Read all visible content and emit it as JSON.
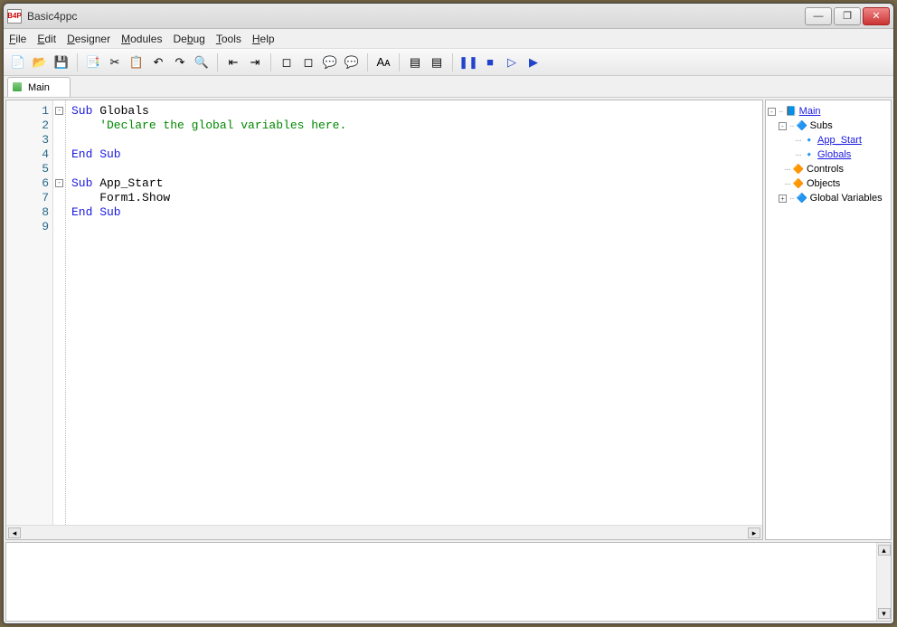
{
  "window": {
    "title": "Basic4ppc",
    "icon_text": "B4P"
  },
  "winbuttons": {
    "min": "—",
    "max": "❐",
    "close": "✕"
  },
  "menus": [
    {
      "label": "File",
      "accel": "F"
    },
    {
      "label": "Edit",
      "accel": "E"
    },
    {
      "label": "Designer",
      "accel": "D"
    },
    {
      "label": "Modules",
      "accel": "M"
    },
    {
      "label": "Debug",
      "accel": "b"
    },
    {
      "label": "Tools",
      "accel": "T"
    },
    {
      "label": "Help",
      "accel": "H"
    }
  ],
  "toolbar_groups": [
    [
      {
        "name": "new-icon",
        "glyph": "📄"
      },
      {
        "name": "open-icon",
        "glyph": "📂"
      },
      {
        "name": "save-icon",
        "glyph": "💾"
      }
    ],
    [
      {
        "name": "copy-icon",
        "glyph": "📑"
      },
      {
        "name": "cut-icon",
        "glyph": "✂"
      },
      {
        "name": "paste-icon",
        "glyph": "📋"
      },
      {
        "name": "undo-icon",
        "glyph": "↶"
      },
      {
        "name": "redo-icon",
        "glyph": "↷"
      },
      {
        "name": "find-icon",
        "glyph": "🔍"
      }
    ],
    [
      {
        "name": "outdent-icon",
        "glyph": "⇤"
      },
      {
        "name": "indent-icon",
        "glyph": "⇥"
      }
    ],
    [
      {
        "name": "breakpoint-icon",
        "glyph": "◻"
      },
      {
        "name": "clear-bp-icon",
        "glyph": "◻"
      },
      {
        "name": "comment-icon",
        "glyph": "💬"
      },
      {
        "name": "uncomment-icon",
        "glyph": "💬"
      }
    ],
    [
      {
        "name": "font-icon",
        "glyph": "Aᴀ"
      }
    ],
    [
      {
        "name": "block-indent-icon",
        "glyph": "▤"
      },
      {
        "name": "block-outdent-icon",
        "glyph": "▤"
      }
    ],
    [
      {
        "name": "pause-icon",
        "glyph": "❚❚",
        "color": "#24c"
      },
      {
        "name": "stop-icon",
        "glyph": "■",
        "color": "#24c"
      },
      {
        "name": "step-icon",
        "glyph": "▷",
        "color": "#24c"
      },
      {
        "name": "run-icon",
        "glyph": "▶",
        "color": "#24c"
      }
    ]
  ],
  "tabs": [
    {
      "label": "Main"
    }
  ],
  "code_lines": [
    {
      "n": 1,
      "fold": "-",
      "segments": [
        {
          "t": "Sub",
          "c": "kw"
        },
        {
          "t": " Globals"
        }
      ]
    },
    {
      "n": 2,
      "segments": [
        {
          "t": "    'Declare the global variables here.",
          "c": "cm"
        }
      ]
    },
    {
      "n": 3,
      "segments": [
        {
          "t": ""
        }
      ]
    },
    {
      "n": 4,
      "segments": [
        {
          "t": "End Sub",
          "c": "kw"
        }
      ]
    },
    {
      "n": 5,
      "segments": [
        {
          "t": ""
        }
      ]
    },
    {
      "n": 6,
      "fold": "-",
      "segments": [
        {
          "t": "Sub",
          "c": "kw"
        },
        {
          "t": " App_Start"
        }
      ]
    },
    {
      "n": 7,
      "segments": [
        {
          "t": "    Form1.Show"
        }
      ]
    },
    {
      "n": 8,
      "segments": [
        {
          "t": "End Sub",
          "c": "kw"
        }
      ]
    },
    {
      "n": 9,
      "segments": [
        {
          "t": ""
        }
      ]
    }
  ],
  "tree": {
    "root": {
      "label": "Main",
      "icon": "📘"
    },
    "subs": {
      "label": "Subs",
      "icon": "🔷"
    },
    "sub_items": [
      {
        "label": "App_Start",
        "icon": "🔹"
      },
      {
        "label": "Globals",
        "icon": "🔹"
      }
    ],
    "controls": {
      "label": "Controls",
      "icon": "🔶"
    },
    "objects": {
      "label": "Objects",
      "icon": "🔶"
    },
    "globals": {
      "label": "Global Variables",
      "icon": "🔷"
    }
  }
}
